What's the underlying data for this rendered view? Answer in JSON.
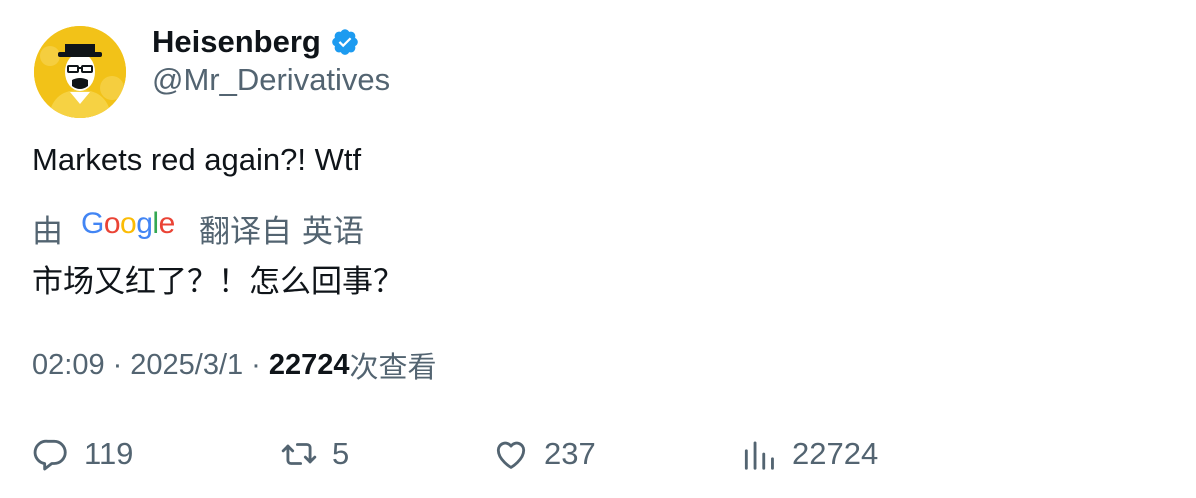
{
  "author": {
    "display_name": "Heisenberg",
    "handle": "@Mr_Derivatives",
    "verified": true,
    "avatar_icon": "heisenberg-avatar"
  },
  "tweet": {
    "text": "Markets red again?! Wtf",
    "translation": {
      "by_label": "由",
      "provider": "Google",
      "from_label": "翻译自 英语",
      "text": "市场又红了？！怎么回事？"
    }
  },
  "meta": {
    "time": "02:09",
    "date": "2025/3/1",
    "views_count": "22724",
    "views_label": "次查看"
  },
  "actions": {
    "replies": "119",
    "reposts": "5",
    "likes": "237",
    "views": "22724"
  },
  "colors": {
    "text_primary": "#0f1419",
    "text_secondary": "#536471",
    "verified_blue": "#1d9bf0",
    "avatar_bg": "#f2c218"
  }
}
